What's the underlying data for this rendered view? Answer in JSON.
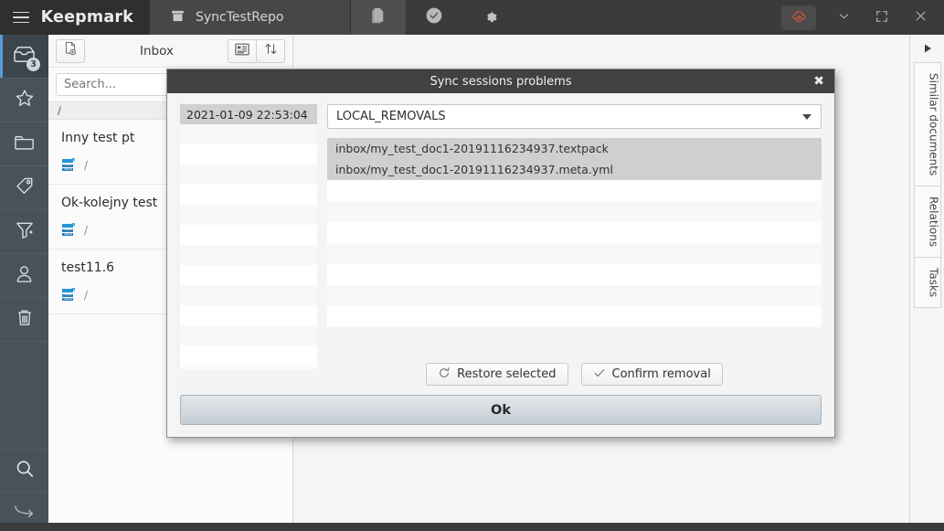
{
  "titlebar": {
    "brand": "Keepmark",
    "menu_icon": "hamburger-icon",
    "repo_tab": {
      "label": "SyncTestRepo",
      "icon": "archive-box-icon"
    },
    "buttons": [
      {
        "name": "documents-view-button",
        "icon": "document-stack-icon"
      },
      {
        "name": "tasks-view-button",
        "icon": "check-circle-icon"
      },
      {
        "name": "settings-button",
        "icon": "gear-icon"
      }
    ],
    "cloud_status": {
      "icon": "cloud-off-icon",
      "color": "#e05a45"
    },
    "window_controls": [
      {
        "name": "minimize-button",
        "icon": "chevron-down-icon"
      },
      {
        "name": "maximize-button",
        "icon": "expand-icon"
      },
      {
        "name": "close-button",
        "icon": "close-icon"
      }
    ]
  },
  "rail": {
    "items": [
      {
        "name": "sidebar-item-inbox",
        "icon": "inbox-icon",
        "badge": "3",
        "selected": true
      },
      {
        "name": "sidebar-item-favorites",
        "icon": "star-icon",
        "badge": "",
        "selected": false
      },
      {
        "name": "sidebar-item-folders",
        "icon": "folder-icon",
        "badge": "",
        "selected": false
      },
      {
        "name": "sidebar-item-tags",
        "icon": "tag-icon",
        "badge": "",
        "selected": false
      },
      {
        "name": "sidebar-item-filters",
        "icon": "funnel-icon",
        "badge": "",
        "selected": false
      },
      {
        "name": "sidebar-item-people",
        "icon": "person-icon",
        "badge": "",
        "selected": false
      },
      {
        "name": "sidebar-item-trash",
        "icon": "trash-icon",
        "badge": "",
        "selected": false
      }
    ],
    "bottom": [
      {
        "name": "sidebar-item-search",
        "icon": "search-icon"
      },
      {
        "name": "sidebar-item-forward",
        "icon": "arrow-forward-icon"
      }
    ]
  },
  "doclist": {
    "new_doc_button": {
      "name": "new-document-button",
      "icon": "new-document-icon"
    },
    "title": "Inbox",
    "view_button": {
      "name": "toggle-view-button",
      "icon": "list-detail-icon"
    },
    "sort_button": {
      "name": "sort-button",
      "icon": "sort-arrows-icon"
    },
    "search": {
      "placeholder": "Search...",
      "value": ""
    },
    "path": "/",
    "items": [
      {
        "name": "Inny test pt",
        "format": "TEXTPACK",
        "path": "/"
      },
      {
        "name": "Ok-kolejny test",
        "format": "TEXTPACK",
        "path": "/"
      },
      {
        "name": "test11.6",
        "format": "TEXTPACK",
        "path": "/"
      }
    ]
  },
  "right_rail": {
    "expand_button": {
      "name": "expand-panel-button",
      "icon": "play-triangle-icon"
    },
    "tabs": [
      {
        "label": "Similar documents"
      },
      {
        "label": "Relations"
      },
      {
        "label": "Tasks"
      }
    ]
  },
  "dialog": {
    "title": "Sync sessions problems",
    "close_icon": "close-icon",
    "sessions": [
      {
        "label": "2021-01-09 22:53:04",
        "selected": true
      },
      {
        "label": "",
        "selected": false
      },
      {
        "label": "",
        "selected": false
      },
      {
        "label": "",
        "selected": false
      },
      {
        "label": "",
        "selected": false
      },
      {
        "label": "",
        "selected": false
      },
      {
        "label": "",
        "selected": false
      },
      {
        "label": "",
        "selected": false
      },
      {
        "label": "",
        "selected": false
      },
      {
        "label": "",
        "selected": false
      },
      {
        "label": "",
        "selected": false
      },
      {
        "label": "",
        "selected": false
      },
      {
        "label": "",
        "selected": false
      }
    ],
    "problem_type": {
      "selected": "LOCAL_REMOVALS",
      "icon": "chevron-down-icon"
    },
    "files": [
      {
        "label": "inbox/my_test_doc1-20191116234937.textpack",
        "selected": true
      },
      {
        "label": "inbox/my_test_doc1-20191116234937.meta.yml",
        "selected": true
      },
      {
        "label": "",
        "selected": false
      },
      {
        "label": "",
        "selected": false
      },
      {
        "label": "",
        "selected": false
      },
      {
        "label": "",
        "selected": false
      },
      {
        "label": "",
        "selected": false
      },
      {
        "label": "",
        "selected": false
      },
      {
        "label": "",
        "selected": false
      }
    ],
    "restore_button": {
      "label": "Restore selected",
      "icon": "restore-arrow-icon"
    },
    "confirm_button": {
      "label": "Confirm removal",
      "icon": "check-icon"
    },
    "ok_button": {
      "label": "Ok"
    }
  }
}
